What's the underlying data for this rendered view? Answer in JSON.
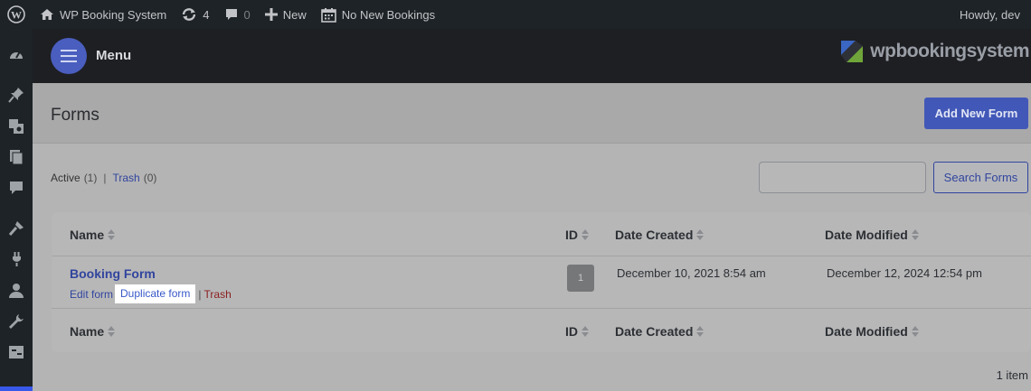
{
  "adminbar": {
    "site_name": "WP Booking System",
    "updates_count": "4",
    "comments_count": "0",
    "new_label": "New",
    "bookings_label": "No New Bookings",
    "howdy": "Howdy, dev"
  },
  "header": {
    "menu_label": "Menu",
    "logo_text": "wpbookingsystem"
  },
  "page": {
    "title": "Forms",
    "add_new_label": "Add New Form"
  },
  "filters": {
    "active_label": "Active",
    "active_count": "(1)",
    "trash_label": "Trash",
    "trash_count": "(0)"
  },
  "search": {
    "placeholder": "",
    "button_label": "Search Forms"
  },
  "table": {
    "columns": [
      "Name",
      "ID",
      "Date Created",
      "Date Modified"
    ],
    "rows": [
      {
        "name": "Booking Form",
        "id": "1",
        "date_created": "December 10, 2021 8:54 am",
        "date_modified": "December 12, 2024 12:54 pm",
        "actions": {
          "edit": "Edit form",
          "duplicate": "Duplicate form",
          "trash": "Trash"
        }
      }
    ]
  },
  "footer": {
    "items_count": "1 item"
  },
  "colors": {
    "accent": "#4258b8",
    "link": "#31459e",
    "trash": "#8b1e1e",
    "logo_blue": "#3a66c4",
    "logo_green": "#6fa53a"
  }
}
